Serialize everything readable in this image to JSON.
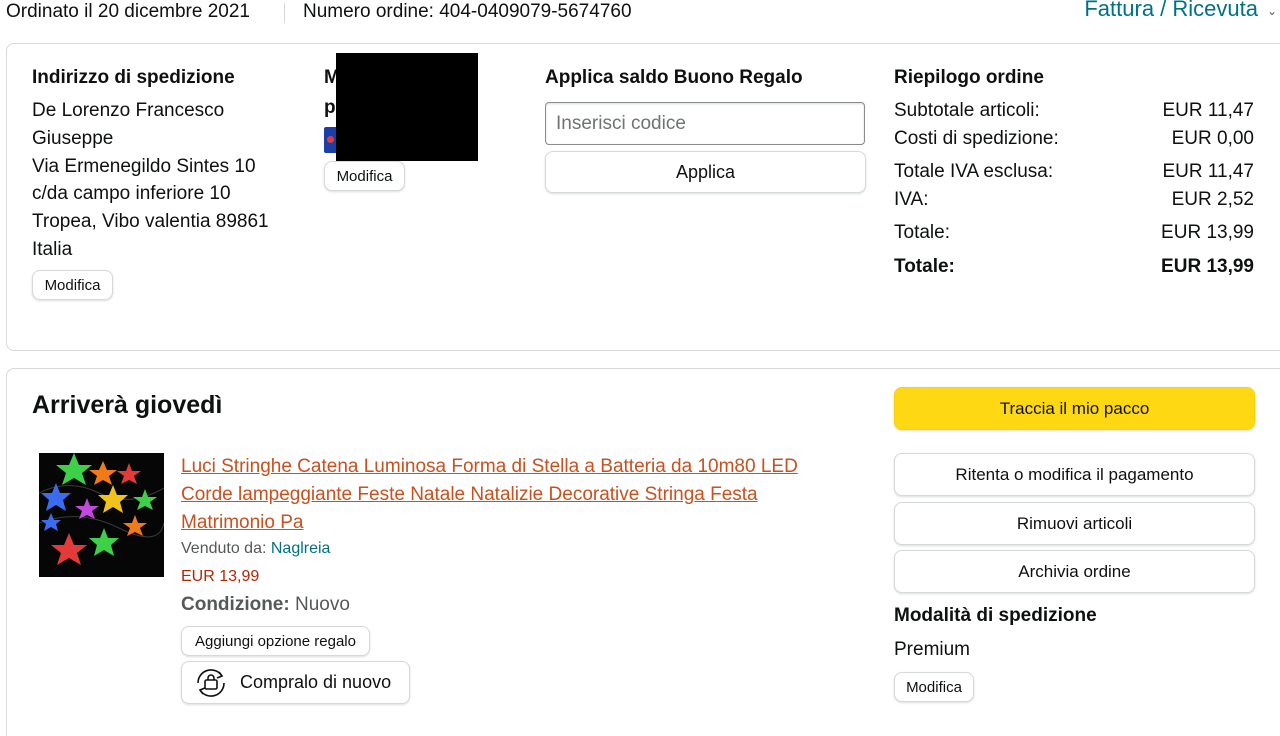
{
  "header": {
    "order_date": "Ordinato il 20 dicembre 2021",
    "order_number": "Numero ordine: 404-0409079-5674760",
    "invoice_link": "Fattura / Ricevuta"
  },
  "shipping_address": {
    "heading": "Indirizzo di spedizione",
    "lines": [
      "De Lorenzo Francesco",
      "Giuseppe",
      "Via Ermenegildo Sintes 10",
      "c/da campo inferiore 10",
      "Tropea, Vibo valentia 89861",
      "Italia"
    ],
    "edit_label": "Modifica"
  },
  "payment": {
    "heading_fragment_1": "M",
    "heading_fragment_2": "p",
    "edit_label": "Modifica"
  },
  "gift_card": {
    "heading": "Applica saldo Buono Regalo",
    "placeholder": "Inserisci codice",
    "apply_label": "Applica"
  },
  "summary": {
    "heading": "Riepilogo ordine",
    "rows": [
      {
        "label": "Subtotale articoli:",
        "value": "EUR 11,47"
      },
      {
        "label": "Costi di spedizione:",
        "value": "EUR 0,00"
      },
      {
        "label": "Totale IVA esclusa:",
        "value": "EUR 11,47"
      },
      {
        "label": "IVA:",
        "value": "EUR 2,52"
      },
      {
        "label": "Totale:",
        "value": "EUR 13,99"
      },
      {
        "label": "Totale:",
        "value": "EUR 13,99"
      }
    ]
  },
  "shipment": {
    "arrival": "Arriverà giovedì",
    "product": {
      "title": "Luci Stringhe Catena Luminosa Forma di Stella a Batteria da 10m80 LED Corde lampeggiante Feste Natale Natalizie Decorative Stringa Festa Matrimonio Pa",
      "sold_by_label": "Venduto da: ",
      "seller": "Naglreia",
      "price": "EUR 13,99",
      "condition_label": "Condizione:",
      "condition_value": "Nuovo",
      "gift_option_label": "Aggiungi opzione regalo",
      "buy_again_label": "Compralo di nuovo"
    },
    "actions": {
      "track": "Traccia il mio pacco",
      "retry_payment": "Ritenta o modifica il pagamento",
      "remove_items": "Rimuovi articoli",
      "archive": "Archivia ordine"
    },
    "shipping_method": {
      "heading": "Modalità di spedizione",
      "value": "Premium",
      "edit_label": "Modifica"
    }
  },
  "colors": {
    "link_teal": "#007185",
    "product_link": "#c7511f",
    "price_red": "#b12704",
    "track_button": "#ffd814",
    "redaction": "#000000"
  },
  "icons": [
    "chevron-down-icon",
    "card-icon",
    "buy-again-icon"
  ]
}
